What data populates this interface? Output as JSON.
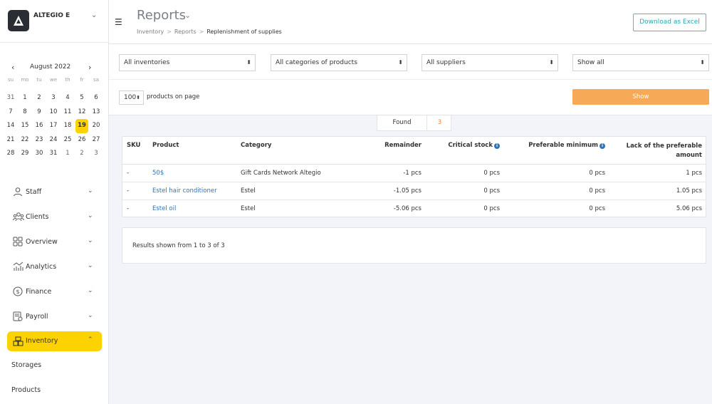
{
  "brand": {
    "name": "ALTEGIO E"
  },
  "calendar": {
    "month_label": "August 2022",
    "weekdays": [
      "su",
      "mo",
      "tu",
      "we",
      "th",
      "fr",
      "sa"
    ],
    "days": [
      [
        "31",
        "1",
        "2",
        "3",
        "4",
        "5",
        "6"
      ],
      [
        "7",
        "8",
        "9",
        "10",
        "11",
        "12",
        "13"
      ],
      [
        "14",
        "15",
        "16",
        "17",
        "18",
        "19",
        "20"
      ],
      [
        "21",
        "22",
        "23",
        "24",
        "25",
        "26",
        "27"
      ],
      [
        "28",
        "29",
        "30",
        "31",
        "1",
        "2",
        "3"
      ]
    ],
    "selected_day": "19"
  },
  "nav": {
    "items": [
      {
        "label": "Staff",
        "icon": "person-icon"
      },
      {
        "label": "Clients",
        "icon": "clients-icon"
      },
      {
        "label": "Overview",
        "icon": "overview-icon"
      },
      {
        "label": "Analytics",
        "icon": "analytics-icon"
      },
      {
        "label": "Finance",
        "icon": "finance-icon"
      },
      {
        "label": "Payroll",
        "icon": "payroll-icon"
      },
      {
        "label": "Inventory",
        "icon": "inventory-icon",
        "active": true
      }
    ],
    "sub_items": [
      {
        "label": "Storages"
      },
      {
        "label": "Products"
      }
    ]
  },
  "header": {
    "title": "Reports",
    "breadcrumb": [
      "Inventory",
      "Reports",
      "Replenishment of supplies"
    ],
    "excel_button": "Download as Excel"
  },
  "filters": {
    "inventories": "All inventories",
    "categories": "All categories of products",
    "suppliers": "All suppliers",
    "show": "Show all",
    "per_page_value": "100",
    "per_page_label": "products on page",
    "show_button": "Show"
  },
  "found": {
    "label": "Found",
    "count": "3"
  },
  "table": {
    "columns": {
      "sku": "SKU",
      "product": "Product",
      "category": "Category",
      "remainder": "Remainder",
      "critical": "Critical stock",
      "preferable": "Preferable minimum",
      "lack_line1": "Lack of the preferable",
      "lack_line2": "amount"
    },
    "rows": [
      {
        "sku": "-",
        "product": "50$",
        "category": "Gift Cards Network Altegio",
        "remainder": "-1 pcs",
        "critical": "0 pcs",
        "preferable": "0 pcs",
        "lack": "1 pcs"
      },
      {
        "sku": "-",
        "product": "Estel hair conditioner",
        "category": "Estel",
        "remainder": "-1.05 pcs",
        "critical": "0 pcs",
        "preferable": "0 pcs",
        "lack": "1.05 pcs"
      },
      {
        "sku": "-",
        "product": "Estel oil",
        "category": "Estel",
        "remainder": "-5.06 pcs",
        "critical": "0 pcs",
        "preferable": "0 pcs",
        "lack": "5.06 pcs"
      }
    ]
  },
  "results": {
    "text": "Results shown from 1 to 3 of 3"
  },
  "colors": {
    "accent": "#fcd200",
    "show_button": "#f6a956",
    "link": "#2f74b5",
    "excel_border": "#3ec2c9"
  }
}
